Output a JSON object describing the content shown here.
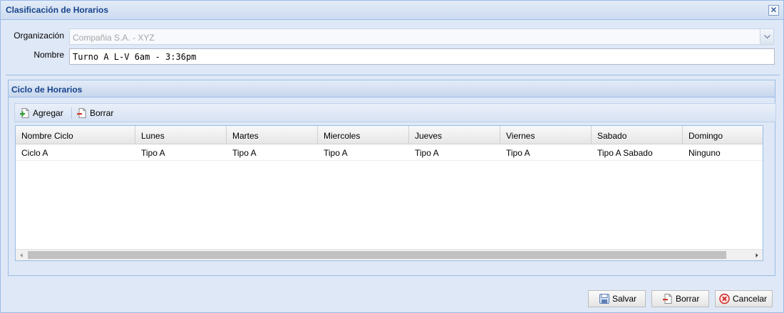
{
  "window": {
    "title": "Clasificación de Horarios",
    "close_icon": "close-icon",
    "close_glyph": "✕"
  },
  "form": {
    "organizacion_label": "Organización",
    "organizacion_value": "Compañia S.A. - XYZ",
    "nombre_label": "Nombre",
    "nombre_value": "Turno A L-V 6am - 3:36pm"
  },
  "ciclo": {
    "title": "Ciclo de Horarios",
    "toolbar": {
      "add_label": "Agregar",
      "add_icon": "add-page-icon",
      "delete_label": "Borrar",
      "delete_icon": "remove-page-icon"
    },
    "grid": {
      "columns": [
        "Nombre Ciclo",
        "Lunes",
        "Martes",
        "Miercoles",
        "Jueves",
        "Viernes",
        "Sabado",
        "Domingo"
      ],
      "rows": [
        [
          "Ciclo A",
          "Tipo A",
          "Tipo A",
          "Tipo A",
          "Tipo A",
          "Tipo A",
          "Tipo A Sabado",
          "Ninguno"
        ]
      ]
    }
  },
  "footer": {
    "save_label": "Salvar",
    "save_icon": "save-icon",
    "delete_label": "Borrar",
    "delete_icon": "delete-icon",
    "cancel_label": "Cancelar",
    "cancel_icon": "cancel-icon"
  },
  "colors": {
    "window_bg": "#dfe8f6",
    "border": "#99bbe8",
    "title_text": "#15428b",
    "cancel_red": "#cc2222"
  }
}
